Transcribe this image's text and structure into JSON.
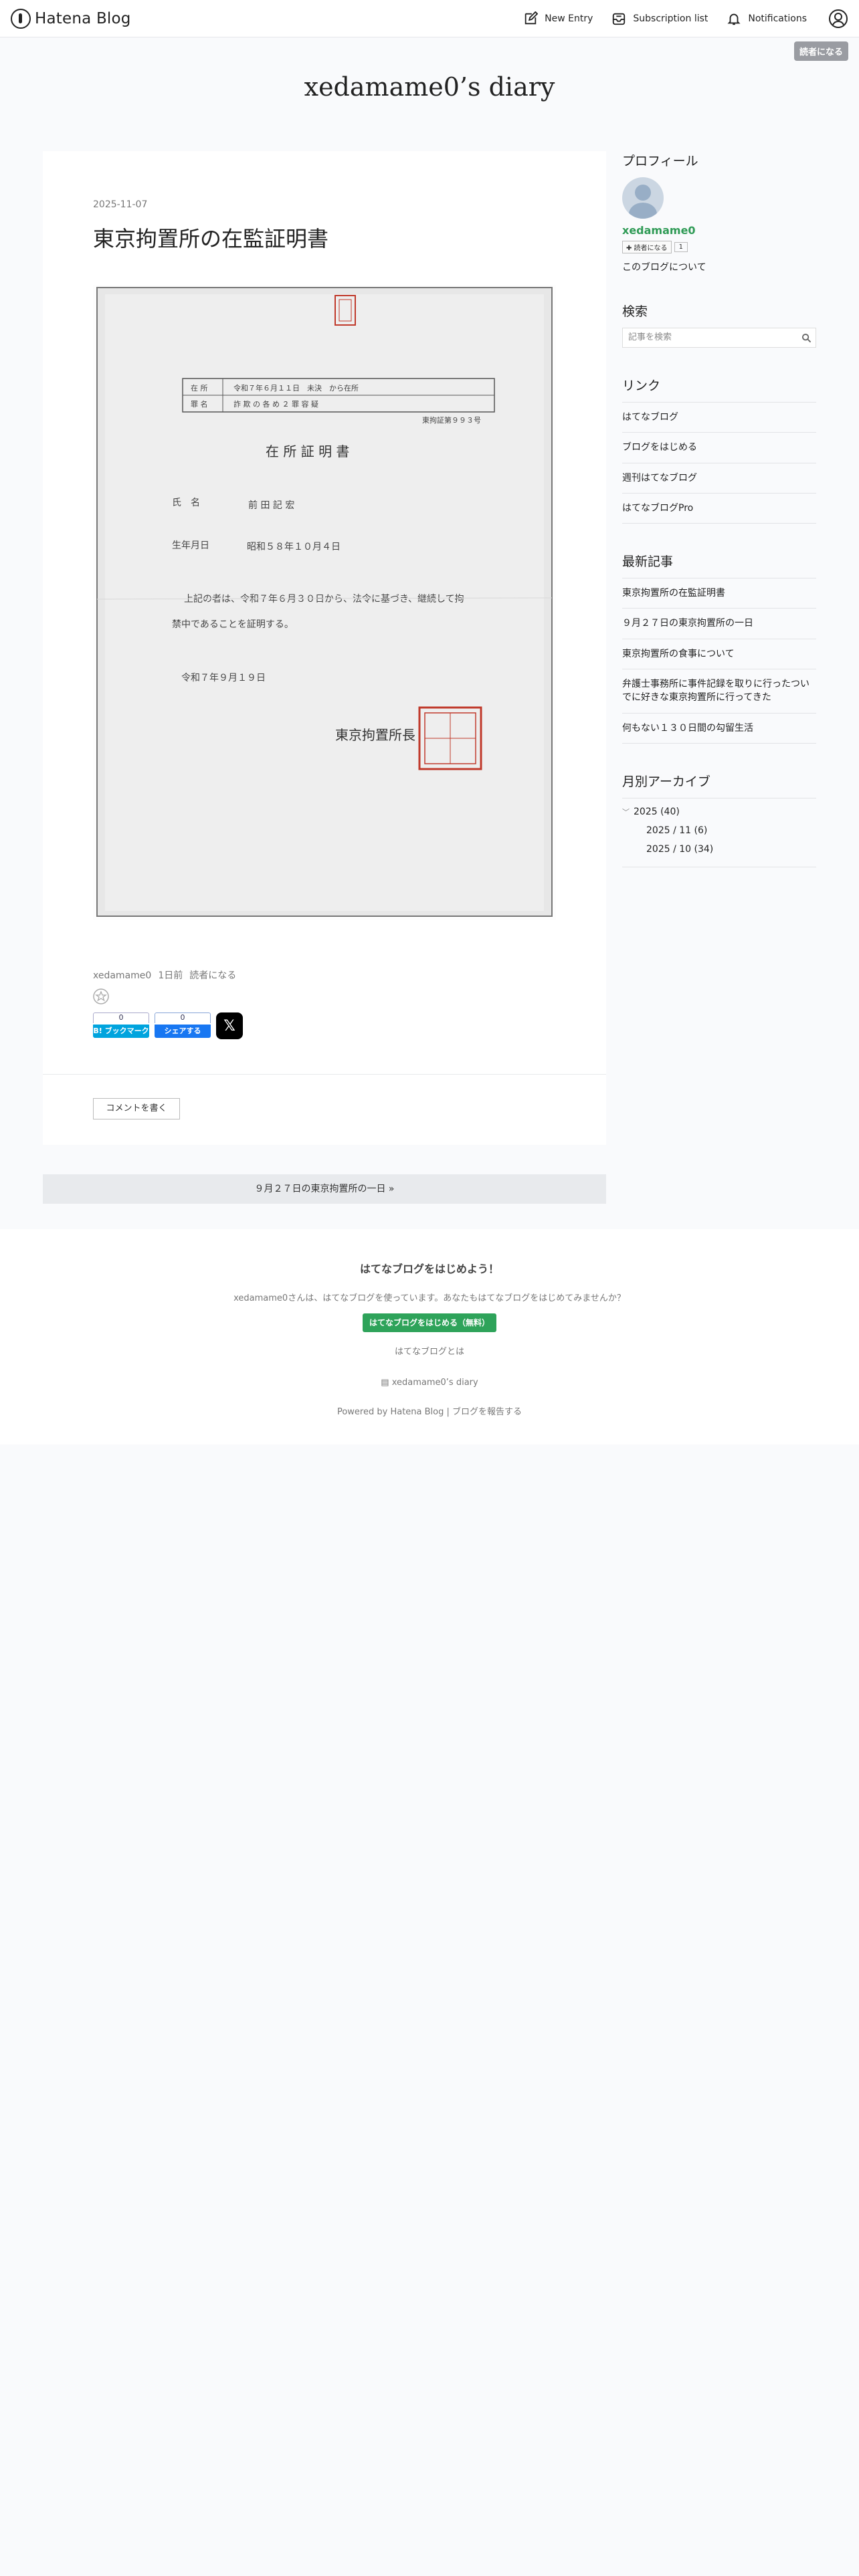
{
  "header": {
    "logo_text": "Hatena Blog",
    "nav": {
      "new_entry": "New Entry",
      "subscription_list": "Subscription list",
      "notifications": "Notifications"
    },
    "subscribe_badge": "読者になる"
  },
  "blog": {
    "title": "xedamame0’s diary"
  },
  "entry": {
    "date": "2025-11-07",
    "title": "東京拘置所の在監証明書",
    "document": {
      "row1_label": "在 所",
      "row1_value": "令和７年６月１１日　未決　から在所",
      "row2_label": "罪 名",
      "row2_value": "詐 欺 の 各 め ２ 罪 容 疑",
      "number": "東拘証第９９３号",
      "heading": "在 所 証 明 書",
      "name_label": "氏　名",
      "name_value": "前 田 記 宏",
      "birth_label": "生年月日",
      "birth_value": "昭和５８年１０月４日",
      "body_line1": "上記の者は、令和７年６月３０日から、法令に基づき、継続して拘",
      "body_line2": "禁中であることを証明する。",
      "issue_date": "令和７年９月１９日",
      "issuer": "東京拘置所長"
    },
    "meta_author": "xedamame0",
    "meta_time": "1日前",
    "meta_reader": "読者になる",
    "share": {
      "hatena_count": "0",
      "hatena_label": "B! ブックマーク",
      "fb_count": "0",
      "fb_label": "シェアする",
      "x_label": "𝕏"
    },
    "comment_button": "コメントを書く"
  },
  "pager": {
    "next": "９月２７日の東京拘置所の一日 »"
  },
  "sidebar": {
    "profile": {
      "title": "プロフィール",
      "name": "xedamame0",
      "reader_button": "✚ 読者になる",
      "reader_count": "1",
      "about": "このブログについて"
    },
    "search": {
      "title": "検索",
      "placeholder": "記事を検索"
    },
    "links": {
      "title": "リンク",
      "items": [
        "はてなブログ",
        "ブログをはじめる",
        "週刊はてなブログ",
        "はてなブログPro"
      ]
    },
    "recent": {
      "title": "最新記事",
      "items": [
        "東京拘置所の在監証明書",
        "９月２７日の東京拘置所の一日",
        "東京拘置所の食事について",
        "弁護士事務所に事件記録を取りに行ったついでに好きな東京拘置所に行ってきた",
        "何もない１３０日間の勾留生活"
      ]
    },
    "archive": {
      "title": "月別アーカイブ",
      "year": "2025 (40)",
      "months": [
        "2025 / 11 (6)",
        "2025 / 10 (34)"
      ]
    }
  },
  "footer": {
    "title": "はてなブログをはじめよう！",
    "text": "xedamame0さんは、はてなブログを使っています。あなたもはてなブログをはじめてみませんか？",
    "start_button": "はてなブログをはじめる（無料）",
    "about": "はてなブログとは",
    "blog_link": "xedamame0’s diary",
    "powered": "Powered by Hatena Blog | ブログを報告する"
  },
  "colors": {
    "accent_green": "#2e9a55",
    "hatena_blue": "#00a4de",
    "facebook_blue": "#1877f2",
    "seal_red": "#c0392b"
  }
}
